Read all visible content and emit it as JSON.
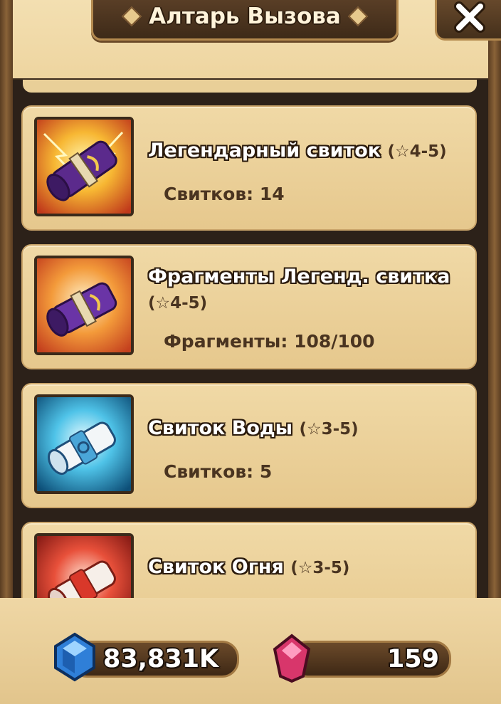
{
  "header": {
    "title": "Алтарь Вызова",
    "close_icon": "close-icon"
  },
  "scrolls": [
    {
      "name": "Легендарный свиток",
      "stars": "(☆4-5)",
      "count_text": "Свитков: 14",
      "icon": "legendary-scroll-icon"
    },
    {
      "name": "Фрагменты Легенд. свитка",
      "stars": "(☆4-5)",
      "count_text": "Фрагменты: 108/100",
      "icon": "legendary-scroll-fragments-icon"
    },
    {
      "name": "Свиток Воды",
      "stars": "(☆3-5)",
      "count_text": "Свитков: 5",
      "icon": "water-scroll-icon"
    },
    {
      "name": "Свиток Огня",
      "stars": "(☆3-5)",
      "count_text": "",
      "icon": "fire-scroll-icon"
    }
  ],
  "currency": {
    "mana_value": "83,831K",
    "mana_icon": "blue-crystal-icon",
    "crystal_value": "159",
    "crystal_icon": "red-crystal-icon"
  },
  "colors": {
    "parchment": "#efd7a5",
    "frame_brown": "#5d4128",
    "text_dark": "#4a3420"
  }
}
